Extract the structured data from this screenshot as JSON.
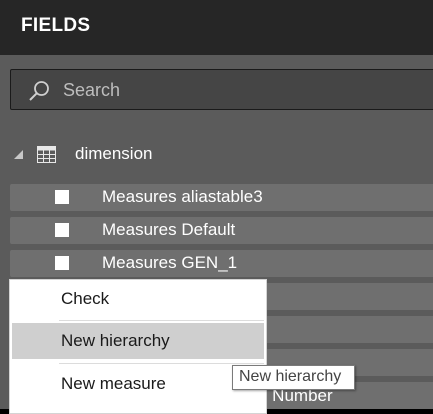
{
  "header": {
    "title": "FIELDS"
  },
  "search": {
    "placeholder": "Search",
    "icon": "search-icon"
  },
  "table": {
    "name": "dimension",
    "icon": "table-icon",
    "expanded": true
  },
  "fields": [
    {
      "label": "Measures aliastable3",
      "checked": false
    },
    {
      "label": "Measures Default",
      "checked": false
    },
    {
      "label": "Measures GEN_1",
      "checked": false
    },
    {
      "label": "",
      "checked": false
    },
    {
      "label": "",
      "checked": false
    },
    {
      "label": "",
      "checked": false
    },
    {
      "label": "n Number",
      "checked": false
    }
  ],
  "context_menu": {
    "items": [
      {
        "label": "Check",
        "highlighted": false
      },
      {
        "label": "New hierarchy",
        "highlighted": true
      },
      {
        "label": "New measure",
        "highlighted": false
      }
    ]
  },
  "tooltip": {
    "text": "New hierarchy"
  },
  "colors": {
    "header_bg": "#262626",
    "panel_bg": "#5b5b5b",
    "row_bg": "#6f6f6f",
    "menu_highlight": "#cfcfcf"
  }
}
